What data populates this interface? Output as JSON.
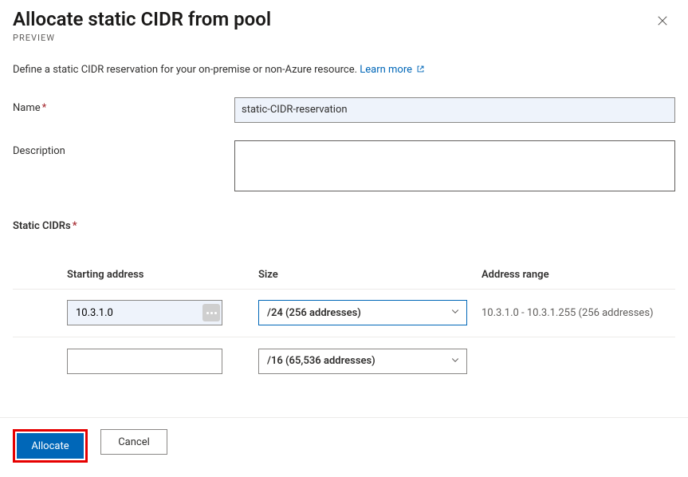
{
  "header": {
    "title": "Allocate static CIDR from pool",
    "preview_label": "PREVIEW"
  },
  "intro": {
    "text": "Define a static CIDR reservation for your on-premise or non-Azure resource. ",
    "learn_more_label": "Learn more"
  },
  "form": {
    "name_label": "Name",
    "name_value": "static-CIDR-reservation",
    "description_label": "Description",
    "description_value": ""
  },
  "static_cidrs": {
    "section_label": "Static CIDRs",
    "columns": {
      "starting_address": "Starting address",
      "size": "Size",
      "address_range": "Address range"
    },
    "rows": [
      {
        "starting_address": "10.3.1.0",
        "size_label": "/24 (256 addresses)",
        "address_range": "10.3.1.0 - 10.3.1.255 (256 addresses)"
      },
      {
        "starting_address": "",
        "size_label": "/16 (65,536 addresses)",
        "address_range": ""
      }
    ]
  },
  "footer": {
    "allocate_label": "Allocate",
    "cancel_label": "Cancel"
  }
}
